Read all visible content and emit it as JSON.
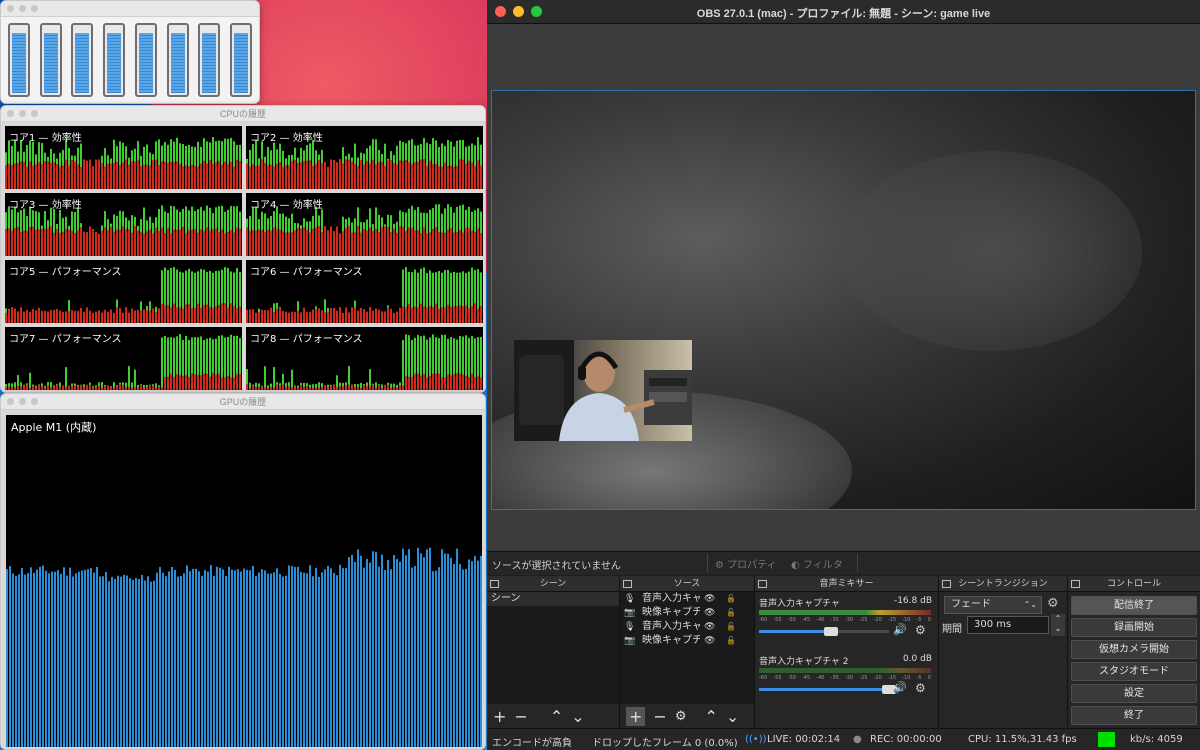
{
  "meters_window": {
    "meter_count": 8,
    "levels": [
      0.86,
      0.86,
      0.86,
      0.86,
      0.86,
      0.86,
      0.86,
      0.86
    ]
  },
  "cpu_window": {
    "title": "CPUの履歴",
    "cores": [
      {
        "label": "コア1 — 効率性"
      },
      {
        "label": "コア2 — 効率性"
      },
      {
        "label": "コア3 — 効率性"
      },
      {
        "label": "コア4 — 効率性"
      },
      {
        "label": "コア5 — パフォーマンス"
      },
      {
        "label": "コア6 — パフォーマンス"
      },
      {
        "label": "コア7 — パフォーマンス"
      },
      {
        "label": "コア8 — パフォーマンス"
      }
    ]
  },
  "gpu_window": {
    "title": "GPUの履歴",
    "device_label": "Apple M1 (内蔵)"
  },
  "obs": {
    "title": "OBS 27.0.1 (mac) - プロファイル: 無題 - シーン: game live",
    "no_source_text": "ソースが選択されていません",
    "properties_label": "プロパティ",
    "filters_label": "フィルタ",
    "panels": {
      "scenes": {
        "title": "シーン",
        "items": [
          "シーン"
        ]
      },
      "sources": {
        "title": "ソース",
        "items": [
          {
            "label": "音声入力キャプチャ",
            "icon": "mic-icon"
          },
          {
            "label": "映像キャプチャ",
            "icon": "camera-icon"
          },
          {
            "label": "音声入力キャプチャ",
            "icon": "mic-icon"
          },
          {
            "label": "映像キャプチャ",
            "icon": "camera-icon"
          }
        ]
      },
      "mixer": {
        "title": "音声ミキサー",
        "channels": [
          {
            "name": "音声入力キャプチャ",
            "db": "-16.8 dB",
            "volume": 0.55
          },
          {
            "name": "音声入力キャプチャ 2",
            "db": "0.0 dB",
            "volume": 1.0
          }
        ],
        "scale": [
          "-60",
          "-55",
          "-50",
          "-45",
          "-40",
          "-35",
          "-30",
          "-25",
          "-20",
          "-15",
          "-10",
          "-5",
          "0"
        ]
      },
      "transition": {
        "title": "シーントランジション",
        "type": "フェード",
        "duration_label": "期間",
        "duration_value": "300 ms"
      },
      "controls": {
        "title": "コントロール",
        "buttons": [
          "配信終了",
          "録画開始",
          "仮想カメラ開始",
          "スタジオモード",
          "設定",
          "終了"
        ]
      }
    },
    "status": {
      "encode": "エンコードが高負",
      "dropped": "ドロップしたフレーム 0 (0.0%)",
      "live": "LIVE: 00:02:14",
      "rec": "REC: 00:00:00",
      "cpu": "CPU: 11.5%,31.43 fps",
      "kbps": "kb/s: 4059"
    }
  }
}
